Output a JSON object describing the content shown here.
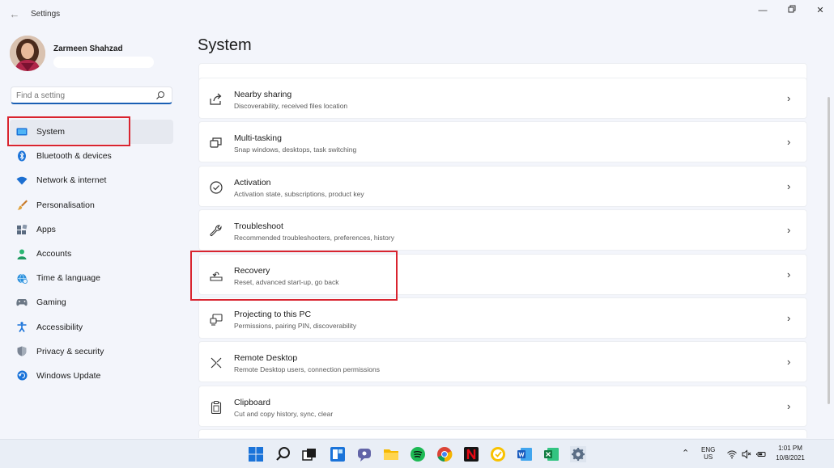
{
  "window": {
    "title": "Settings"
  },
  "profile": {
    "name": "Zarmeen Shahzad"
  },
  "search": {
    "placeholder": "Find a setting"
  },
  "page": {
    "title": "System"
  },
  "sidebar": {
    "items": [
      {
        "label": "System",
        "icon": "monitor-icon",
        "active": true
      },
      {
        "label": "Bluetooth & devices",
        "icon": "bluetooth-icon"
      },
      {
        "label": "Network & internet",
        "icon": "wifi-icon"
      },
      {
        "label": "Personalisation",
        "icon": "brush-icon"
      },
      {
        "label": "Apps",
        "icon": "apps-icon"
      },
      {
        "label": "Accounts",
        "icon": "person-icon"
      },
      {
        "label": "Time & language",
        "icon": "globe-clock-icon"
      },
      {
        "label": "Gaming",
        "icon": "gamepad-icon"
      },
      {
        "label": "Accessibility",
        "icon": "accessibility-icon"
      },
      {
        "label": "Privacy & security",
        "icon": "shield-icon"
      },
      {
        "label": "Windows Update",
        "icon": "update-icon"
      }
    ]
  },
  "settings": [
    {
      "title": "Nearby sharing",
      "desc": "Discoverability, received files location",
      "icon": "share-icon"
    },
    {
      "title": "Multi-tasking",
      "desc": "Snap windows, desktops, task switching",
      "icon": "multitask-icon"
    },
    {
      "title": "Activation",
      "desc": "Activation state, subscriptions, product key",
      "icon": "check-circle-icon"
    },
    {
      "title": "Troubleshoot",
      "desc": "Recommended troubleshooters, preferences, history",
      "icon": "wrench-icon"
    },
    {
      "title": "Recovery",
      "desc": "Reset, advanced start-up, go back",
      "icon": "recovery-icon"
    },
    {
      "title": "Projecting to this PC",
      "desc": "Permissions, pairing PIN, discoverability",
      "icon": "project-icon"
    },
    {
      "title": "Remote Desktop",
      "desc": "Remote Desktop users, connection permissions",
      "icon": "remote-desktop-icon"
    },
    {
      "title": "Clipboard",
      "desc": "Cut and copy history, sync, clear",
      "icon": "clipboard-icon"
    }
  ],
  "taskbar": {
    "apps": [
      "start-icon",
      "search-icon",
      "task-view-icon",
      "widgets-icon",
      "chat-icon",
      "file-explorer-icon",
      "spotify-icon",
      "chrome-icon",
      "netflix-icon",
      "norton-icon",
      "word-icon",
      "excel-icon",
      "settings-icon"
    ],
    "tray": {
      "lang_line1": "ENG",
      "lang_line2": "US",
      "time": "1:01 PM",
      "date": "10/8/2021"
    }
  },
  "colors": {
    "accent": "#1a5fb4",
    "highlight": "#d9242f",
    "background": "#f3f5fb"
  }
}
